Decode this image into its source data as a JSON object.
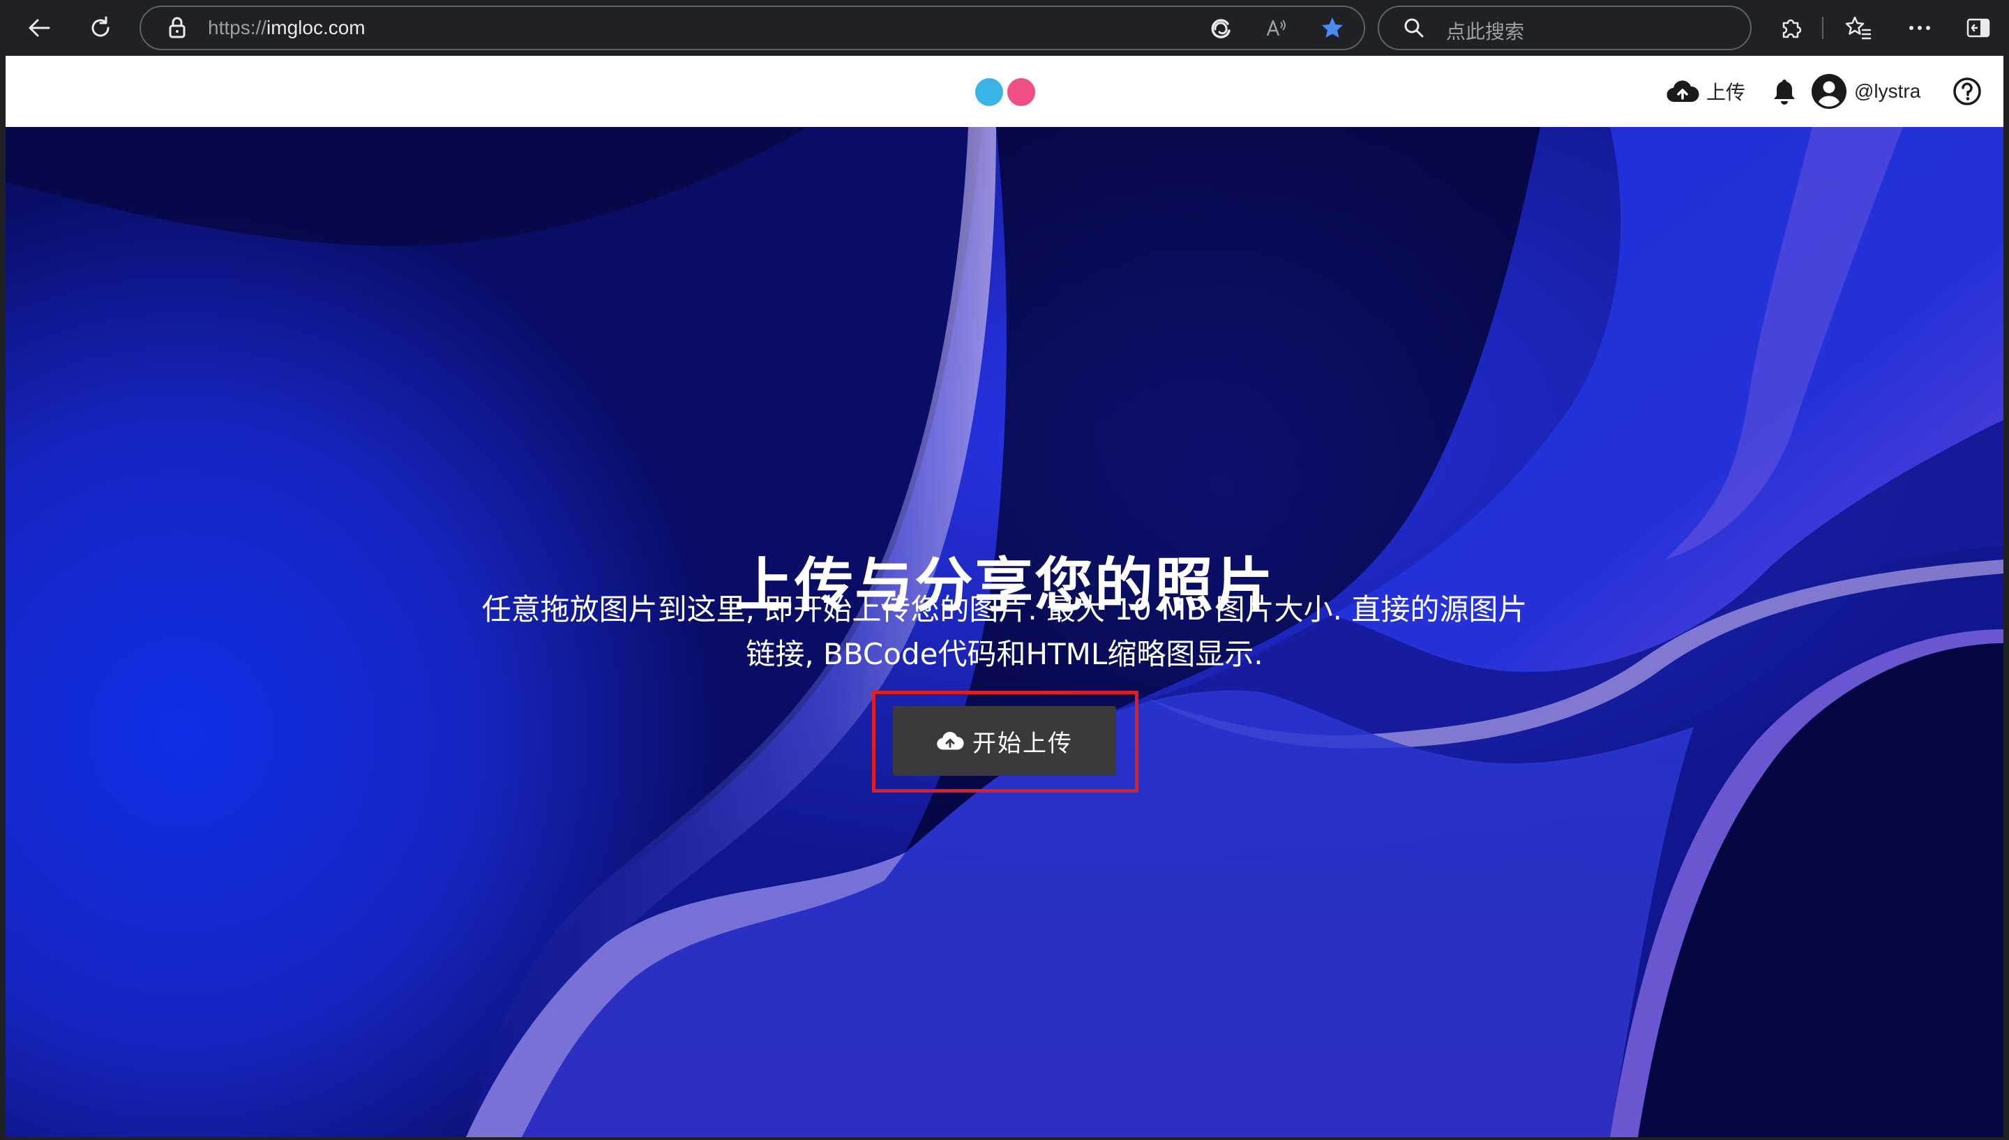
{
  "browser": {
    "url_protocol": "https://",
    "url_host": "imgloc.com",
    "search_placeholder": "点此搜索",
    "accent_color": "#4c8bf5"
  },
  "header": {
    "logo_colors": [
      "#3ab4e6",
      "#ef4f86"
    ],
    "upload_label": "上传",
    "username": "@lystra",
    "icons": [
      "cloud-upload-icon",
      "bell-icon",
      "avatar-icon",
      "help-icon"
    ]
  },
  "hero": {
    "title": "上传与分享您的照片",
    "subtitle_line1": "任意拖放图片到这里, 即开始上传您的图片. 最大 10 MB 图片大小. 直接的源图片",
    "subtitle_line2": "链接, BBCode代码和HTML缩略图显示.",
    "button_label": "开始上传",
    "highlight_color": "#e01e1e"
  }
}
